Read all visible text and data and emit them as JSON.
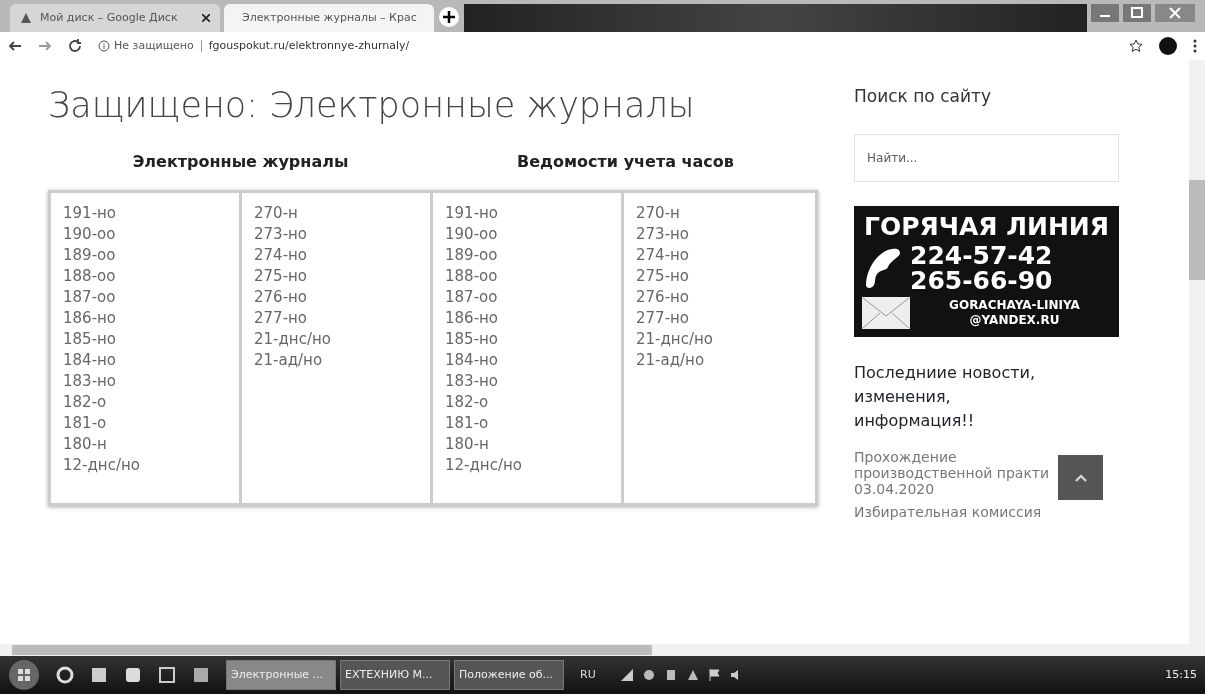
{
  "browser": {
    "tabs": [
      {
        "title": "Мой диск – Google Диск",
        "selected": false
      },
      {
        "title": "Электронные журналы – Крас",
        "selected": true
      }
    ],
    "address": {
      "security": "Не защищено",
      "url": "fgouspokut.ru/elektronnye-zhurnaly/"
    }
  },
  "page": {
    "title": "Защищено: Электронные журналы",
    "table": {
      "headings": [
        "Электронные журналы",
        "Ведомости учета часов"
      ],
      "columns": [
        [
          "191-но",
          "190-оо",
          "189-оо",
          "188-оо",
          "187-оо",
          "186-но",
          "185-но",
          "184-но",
          "183-но",
          "182-о",
          "181-о",
          "180-н",
          "12-днс/но"
        ],
        [
          "270-н",
          "273-но",
          "274-но",
          "275-но",
          "276-но",
          "277-но",
          "21-днс/но",
          "21-ад/но"
        ],
        [
          "191-но",
          "190-оо",
          "189-оо",
          "188-оо",
          "187-оо",
          "186-но",
          "185-но",
          "184-но",
          "183-но",
          "182-о",
          "181-о",
          "180-н",
          "12-днс/но"
        ],
        [
          "270-н",
          "273-но",
          "274-но",
          "275-но",
          "276-но",
          "277-но",
          "21-днс/но",
          "21-ад/но"
        ]
      ]
    }
  },
  "sidebar": {
    "search_title": "Поиск по сайту",
    "search": {
      "placeholder": "Найти..."
    },
    "hotline": {
      "title": "ГОРЯЧАЯ ЛИНИЯ",
      "phones": [
        "224-57-42",
        "265-66-90"
      ],
      "email_lines": [
        "GORACHAYA-LINIYA",
        "@YANDEX.RU"
      ]
    },
    "news_title": "Последниие новости, изменения, информация!!",
    "news": [
      {
        "title": "Прохождение производственной практи",
        "date": "03.04.2020"
      },
      {
        "title": "Избирательная комиссия"
      }
    ]
  },
  "taskbar": {
    "items": [
      {
        "label": "Электронные ...",
        "selected": true
      },
      {
        "label": "ЕХТЕХНИЮ М...",
        "selected": false
      },
      {
        "label": "Положение об...",
        "selected": false
      }
    ],
    "language": "RU",
    "time": "15:15"
  }
}
